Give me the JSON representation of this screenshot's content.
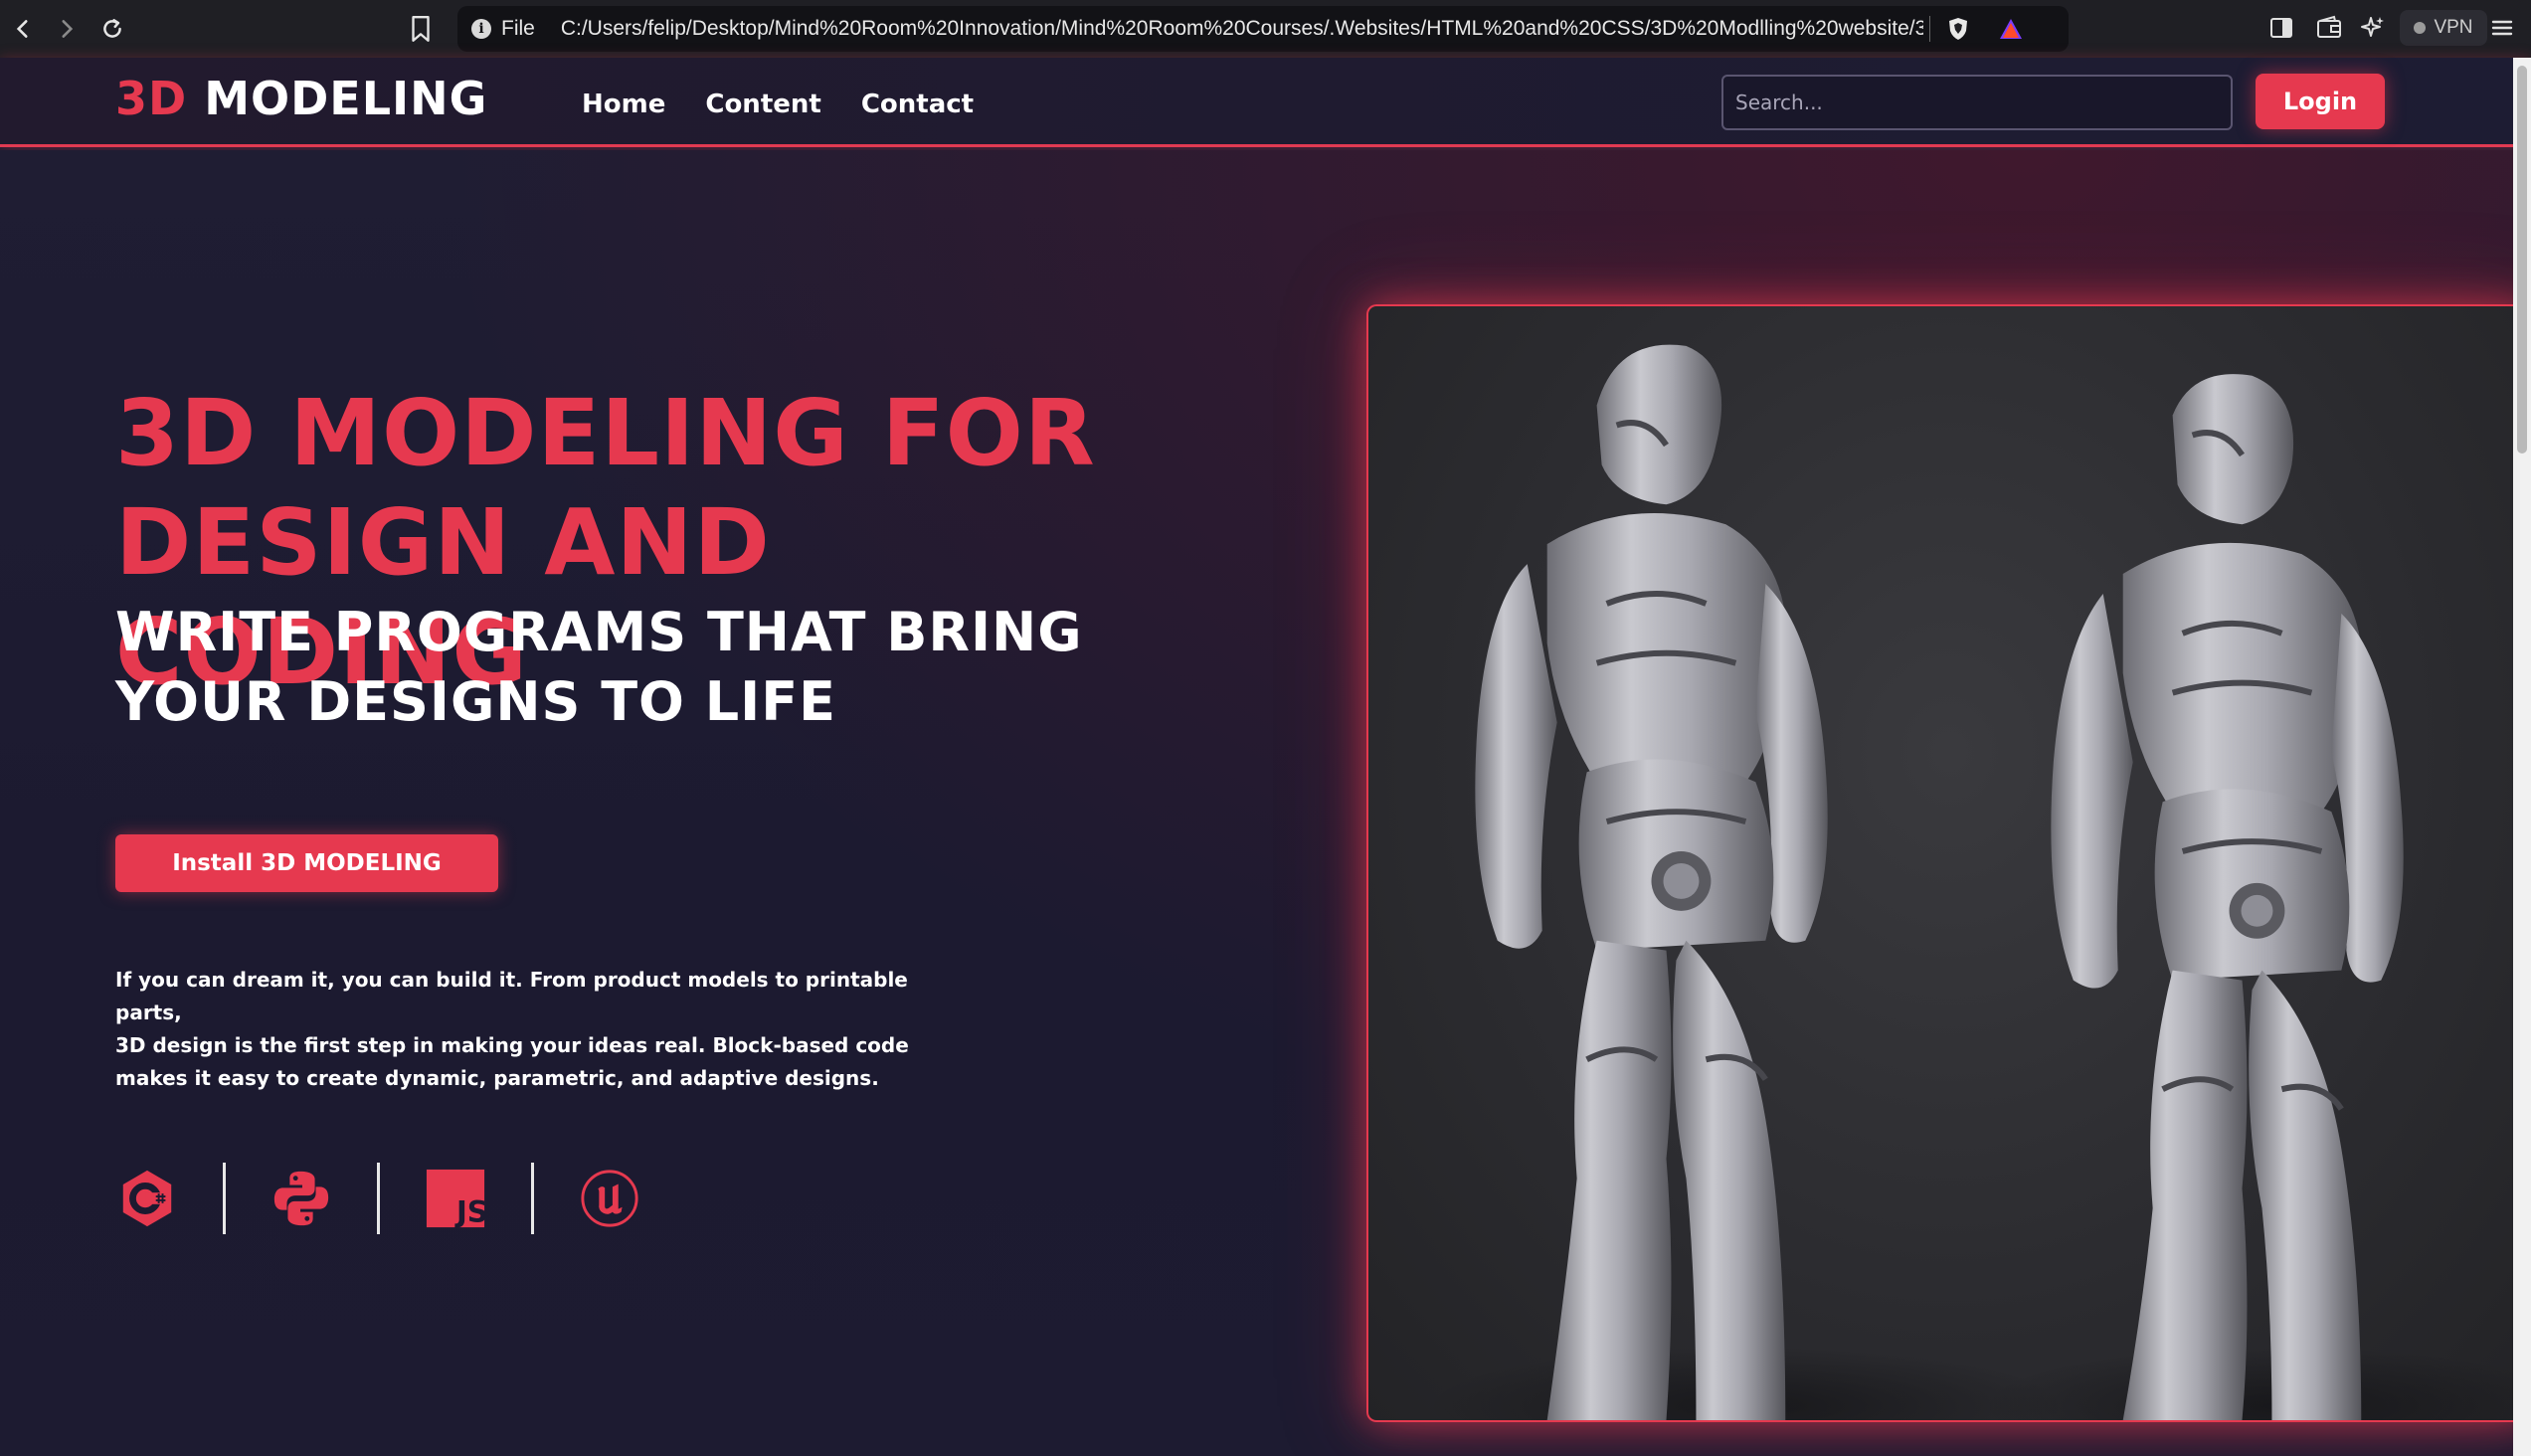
{
  "browser": {
    "file_label": "File",
    "url": "C:/Users/felip/Desktop/Mind%20Room%20Innovation/Mind%20Room%20Courses/.Websites/HTML%20and%20CSS/3D%20Modlling%20website/3...",
    "vpn_label": "VPN"
  },
  "header": {
    "logo_accent": "3D",
    "logo_main": "MODELING",
    "nav": [
      "Home",
      "Content",
      "Contact"
    ],
    "search_placeholder": "Search...",
    "login_label": "Login"
  },
  "hero": {
    "headline_line1": "3D MODELING FOR",
    "headline_line2": "DESIGN AND CODING",
    "sub_line1": "WRITE PROGRAMS THAT BRING",
    "sub_line2": "YOUR DESIGNS TO LIFE",
    "install_label": "Install 3D MODELING",
    "description": [
      "If you can dream it, you can build it. From product models to printable parts,",
      "3D design is the first step in making your ideas real. Block-based code",
      "makes it easy to create dynamic, parametric, and adaptive designs."
    ],
    "tech_icons": [
      "c-sharp-icon",
      "python-icon",
      "javascript-icon",
      "unreal-engine-icon"
    ],
    "js_label": "JS"
  },
  "colors": {
    "accent": "#e6394f",
    "background": "#1c1a30",
    "text": "#ffffff"
  }
}
